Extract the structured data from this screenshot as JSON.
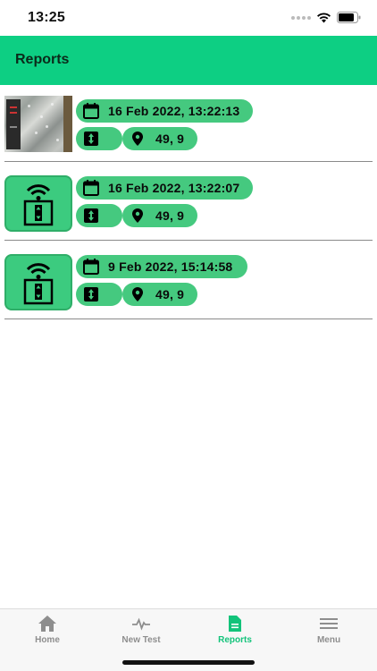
{
  "status_bar": {
    "time": "13:25"
  },
  "header": {
    "title": "Reports"
  },
  "reports": [
    {
      "thumbnail": "photo",
      "datetime": "16 Feb 2022, 13:22:13",
      "location": "49, 9"
    },
    {
      "thumbnail": "elevator-wifi-icon",
      "datetime": "16 Feb 2022, 13:22:07",
      "location": "49, 9"
    },
    {
      "thumbnail": "elevator-wifi-icon",
      "datetime": "9 Feb 2022, 15:14:58",
      "location": "49, 9"
    }
  ],
  "tabs": [
    {
      "label": "Home",
      "icon": "home-icon",
      "active": false
    },
    {
      "label": "New Test",
      "icon": "pulse-icon",
      "active": false
    },
    {
      "label": "Reports",
      "icon": "document-icon",
      "active": true
    },
    {
      "label": "Menu",
      "icon": "menu-icon",
      "active": false
    }
  ],
  "colors": {
    "accent": "#0dcf83",
    "pill": "#45c97f",
    "active_tab": "#12c37a",
    "inactive_tab": "#8e8e8e"
  }
}
